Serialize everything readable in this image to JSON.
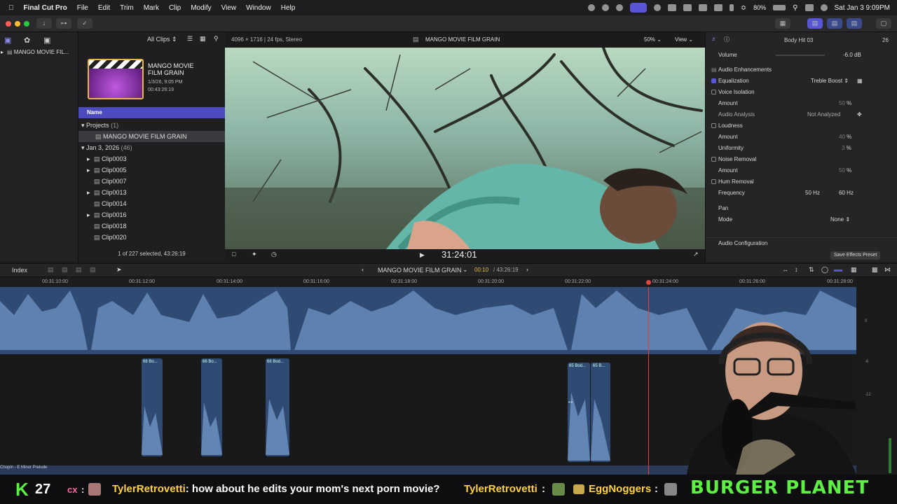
{
  "menubar": {
    "app_name": "Final Cut Pro",
    "items": [
      "File",
      "Edit",
      "Trim",
      "Mark",
      "Clip",
      "Modify",
      "View",
      "Window",
      "Help"
    ],
    "battery": "80%",
    "clock": "Sat Jan 3  9:09PM"
  },
  "library": {
    "name": "MANGO MOVIE FIL..."
  },
  "browser": {
    "filter": "All Clips",
    "project_card": {
      "title_line1": "MANGO MOVIE",
      "title_line2": "FILM GRAIN",
      "date": "1/3/26, 9:05 PM",
      "duration": "00:43:26:19"
    },
    "column_header": "Name",
    "projects_label": "Projects",
    "projects_count": "(1)",
    "project_item": "MANGO MOVIE FILM GRAIN",
    "event_label": "Jan 3, 2026",
    "event_count": "(46)",
    "clips": [
      "Clip0003",
      "Clip0005",
      "Clip0007",
      "Clip0013",
      "Clip0014",
      "Clip0016",
      "Clip0018",
      "Clip0020"
    ],
    "selection_status": "1 of 227 selected, 43:26:19"
  },
  "viewer": {
    "format": "4096 × 1716 | 24 fps, Stereo",
    "title": "MANGO MOVIE FILM GRAIN",
    "zoom": "50%",
    "view_label": "View",
    "timecode": "31:24:01"
  },
  "inspector": {
    "clip_name": "Body Hit 03",
    "clip_number": "26",
    "volume_label": "Volume",
    "volume_value": "-6.0",
    "volume_unit": "dB",
    "audio_enhancements": "Audio Enhancements",
    "equalization": "Equalization",
    "equalization_value": "Treble Boost",
    "voice_isolation": "Voice Isolation",
    "amount": "Amount",
    "vi_amount": "50",
    "pct": "%",
    "audio_analysis": "Audio Analysis",
    "not_analyzed": "Not Analyzed",
    "loudness": "Loudness",
    "loud_amount": "40",
    "uniformity": "Uniformity",
    "uniformity_value": "3",
    "noise_removal": "Noise Removal",
    "nr_amount": "50",
    "hum_removal": "Hum Removal",
    "frequency": "Frequency",
    "freq_50": "50",
    "freq_60": "60",
    "hz": "Hz",
    "pan": "Pan",
    "mode": "Mode",
    "mode_value": "None",
    "audio_config": "Audio Configuration",
    "save_preset": "Save Effects Preset"
  },
  "timeline": {
    "index_label": "Index",
    "project_title": "MANGO MOVIE FILM GRAIN",
    "position": "00:10",
    "duration": "/ 43:26:19",
    "ruler": [
      "00:31:10:00",
      "00:31:12:00",
      "00:31:14:00",
      "00:31:16:00",
      "00:31:18:00",
      "00:31:20:00",
      "00:31:22:00",
      "00:31:24:00",
      "00:31:26:00",
      "00:31:28:00"
    ],
    "clip_labels": [
      "66 Bo...",
      "66 Bo...",
      "66 Bod...",
      "65 Bod...",
      "65 B..."
    ],
    "music_label": "Chopin - E Minor Prelude",
    "meter_labels": [
      "0",
      "-6",
      "-12"
    ]
  },
  "chat": {
    "count": "27",
    "user1": "cx",
    "message1_user": "TylerRetrovetti",
    "message1_text": ": how about he edits your mom's next porn movie?",
    "message2_user": "TylerRetrovetti",
    "message3_user": "EggNoggers",
    "banner": "BURGER PLANET"
  },
  "colors": {
    "accent": "#5856d6",
    "waveform": "#3d5e8a",
    "playhead": "#e0443e",
    "chat_green": "#5cf043"
  }
}
